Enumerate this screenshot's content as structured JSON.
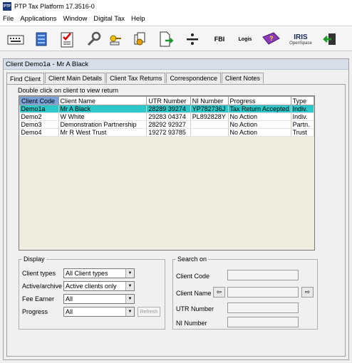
{
  "window": {
    "title": "PTP Tax Platform 17.3516-0",
    "icon_text": "PTP"
  },
  "menubar": {
    "items": [
      "File",
      "Applications",
      "Window",
      "Digital Tax",
      "Help"
    ]
  },
  "toolbar": {
    "fbi_label": "FBI",
    "login_label": "Logis",
    "iris_label": "IRIS",
    "iris_sub": "OpenSpace"
  },
  "panel": {
    "title": "Client Demo1a - Mr A Black"
  },
  "tabs": [
    "Find Client",
    "Client Main Details",
    "Client Tax Returns",
    "Correspondence",
    "Client Notes"
  ],
  "find": {
    "hint": "Double click on client to view return",
    "columns": [
      "Client Code",
      "Client Name",
      "UTR Number",
      "NI Number",
      "Progress",
      "Type"
    ],
    "rows": [
      [
        "Demo1a",
        "Mr A Black",
        "28289 39274",
        "YP782736J",
        "Tax Return Accepted",
        "Indiv."
      ],
      [
        "Demo2",
        "W White",
        "29283 04374",
        "PL892828Y",
        "No Action",
        "Indiv."
      ],
      [
        "Demo3",
        "Demonstration Partnership",
        "28292 92927",
        "",
        "No Action",
        "Partn."
      ],
      [
        "Demo4",
        "Mr R West Trust",
        "19272 93785",
        "",
        "No Action",
        "Trust"
      ]
    ],
    "selected_row": 0
  },
  "display": {
    "legend": "Display",
    "client_types_label": "Client types",
    "client_types_value": "All Client types",
    "active_label": "Active/archive",
    "active_value": "Active clients only",
    "fee_label": "Fee Earner",
    "fee_value": "All",
    "progress_label": "Progress",
    "progress_value": "All",
    "refresh_label": "Refresh"
  },
  "search": {
    "legend": "Search on",
    "code_label": "Client Code",
    "name_label": "Client Name",
    "utr_label": "UTR Number",
    "ni_label": "NI Number"
  },
  "colors": {
    "selected_row": "#2ec7c9",
    "panel_header": "#d6dfea",
    "grid_bg": "#efeede"
  }
}
